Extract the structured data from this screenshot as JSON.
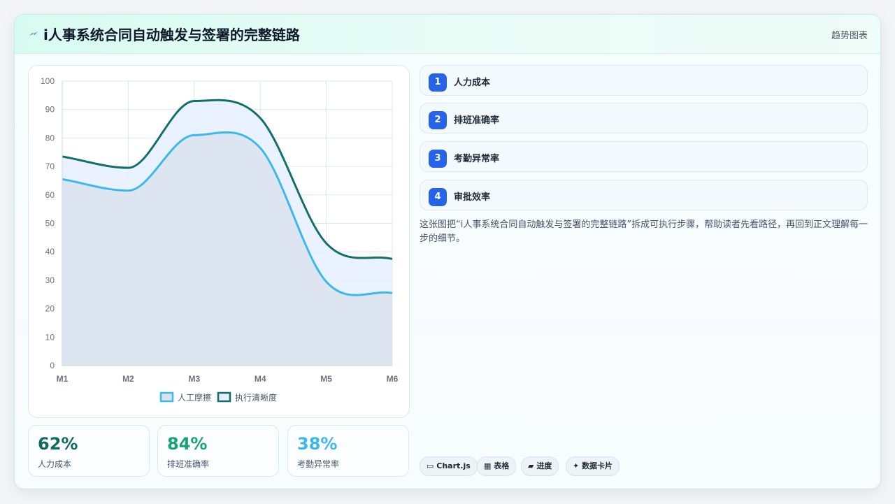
{
  "header": {
    "title": "i人事系统合同自动触发与签署的完整链路",
    "tag": "趋势图表"
  },
  "chart_data": {
    "type": "line",
    "categories": [
      "M1",
      "M2",
      "M3",
      "M4",
      "M5",
      "M6"
    ],
    "y_ticks": [
      0,
      10,
      20,
      30,
      40,
      50,
      60,
      70,
      80,
      90,
      100
    ],
    "ylim": [
      0,
      100
    ],
    "grid": true,
    "legend_position": "bottom",
    "series": [
      {
        "name": "人工摩擦",
        "values": [
          65.5,
          61.5,
          81,
          76.5,
          29.5,
          25.5
        ],
        "color": "#3db8ec",
        "fill": "#dbe3f0"
      },
      {
        "name": "执行清晰度",
        "values": [
          73.5,
          69.5,
          93,
          87,
          43,
          37.5
        ],
        "color": "#136f6a",
        "fill": "#e8efff"
      }
    ]
  },
  "stats": [
    {
      "value": "62%",
      "label": "人力成本",
      "color": "#0f6b5f"
    },
    {
      "value": "84%",
      "label": "排班准确率",
      "color": "#17a673"
    },
    {
      "value": "38%",
      "label": "考勤异常率",
      "color": "#3db8ec"
    }
  ],
  "steps": [
    {
      "num": "1",
      "label": "人力成本"
    },
    {
      "num": "2",
      "label": "排班准确率"
    },
    {
      "num": "3",
      "label": "考勤异常率"
    },
    {
      "num": "4",
      "label": "审批效率"
    }
  ],
  "description": "这张图把“i人事系统合同自动触发与签署的完整链路”拆成可执行步骤，帮助读者先看路径，再回到正文理解每一步的细节。",
  "chips": [
    {
      "icon": "▭",
      "label": "Chart.js"
    },
    {
      "icon": "▦",
      "label": "表格"
    },
    {
      "icon": "▰",
      "label": "进度"
    },
    {
      "icon": "✦",
      "label": "数据卡片"
    }
  ]
}
